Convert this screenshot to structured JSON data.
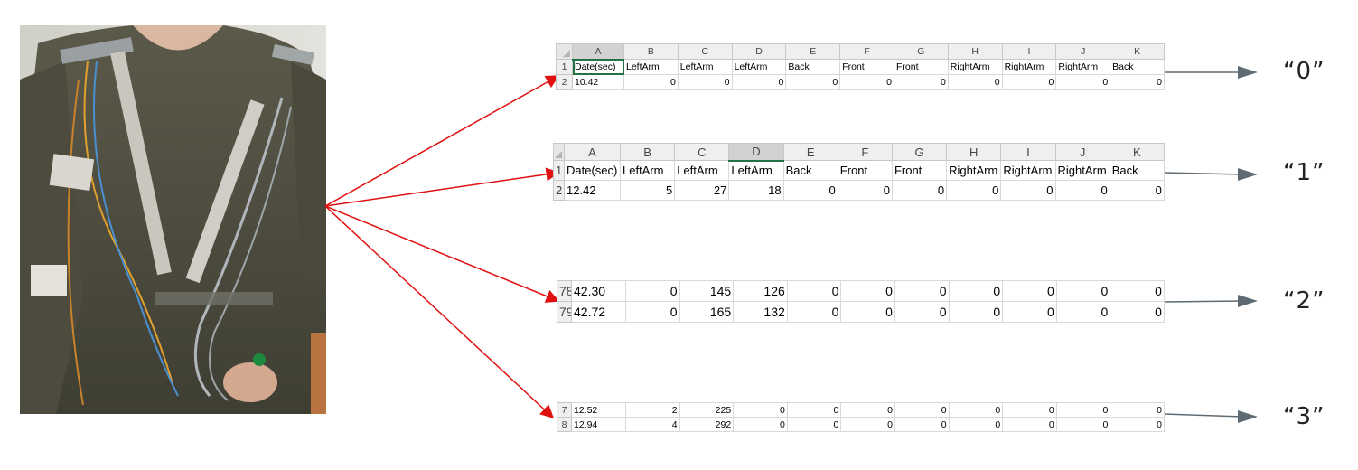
{
  "photo": {
    "description_icon": "wearable-sensor-shirt-photo"
  },
  "colors": {
    "pointer_arrow": "#e01010",
    "output_arrow": "#5f6b73",
    "excel_green": "#217346"
  },
  "column_letters": [
    "A",
    "B",
    "C",
    "D",
    "E",
    "F",
    "G",
    "H",
    "I",
    "J",
    "K"
  ],
  "headers": [
    "Date(sec)",
    "LeftArm",
    "LeftArm",
    "LeftArm",
    "Back",
    "Front",
    "Front",
    "RightArm",
    "RightArm",
    "RightArm",
    "Back"
  ],
  "sheets": [
    {
      "label": "“0”",
      "rows": [
        {
          "num": "1",
          "cells": [
            "Date(sec)",
            "LeftArm",
            "LeftArm",
            "LeftArm",
            "Back",
            "Front",
            "Front",
            "RightArm",
            "RightArm",
            "RightArm",
            "Back"
          ]
        },
        {
          "num": "2",
          "cells": [
            "10.42",
            "0",
            "0",
            "0",
            "0",
            "0",
            "0",
            "0",
            "0",
            "0",
            "0"
          ]
        }
      ]
    },
    {
      "label": "“1”",
      "rows": [
        {
          "num": "1",
          "cells": [
            "Date(sec)",
            "LeftArm",
            "LeftArm",
            "LeftArm",
            "Back",
            "Front",
            "Front",
            "RightArm",
            "RightArm",
            "RightArm",
            "Back"
          ]
        },
        {
          "num": "2",
          "cells": [
            "12.42",
            "5",
            "27",
            "18",
            "0",
            "0",
            "0",
            "0",
            "0",
            "0",
            "0"
          ]
        }
      ]
    },
    {
      "label": "“2”",
      "rows": [
        {
          "num": "78",
          "cells": [
            "42.30",
            "0",
            "145",
            "126",
            "0",
            "0",
            "0",
            "0",
            "0",
            "0",
            "0"
          ]
        },
        {
          "num": "79",
          "cells": [
            "42.72",
            "0",
            "165",
            "132",
            "0",
            "0",
            "0",
            "0",
            "0",
            "0",
            "0"
          ]
        }
      ]
    },
    {
      "label": "“3”",
      "rows": [
        {
          "num": "7",
          "cells": [
            "12.52",
            "2",
            "225",
            "0",
            "0",
            "0",
            "0",
            "0",
            "0",
            "0",
            "0"
          ]
        },
        {
          "num": "8",
          "cells": [
            "12.94",
            "4",
            "292",
            "0",
            "0",
            "0",
            "0",
            "0",
            "0",
            "0",
            "0"
          ]
        }
      ]
    }
  ]
}
